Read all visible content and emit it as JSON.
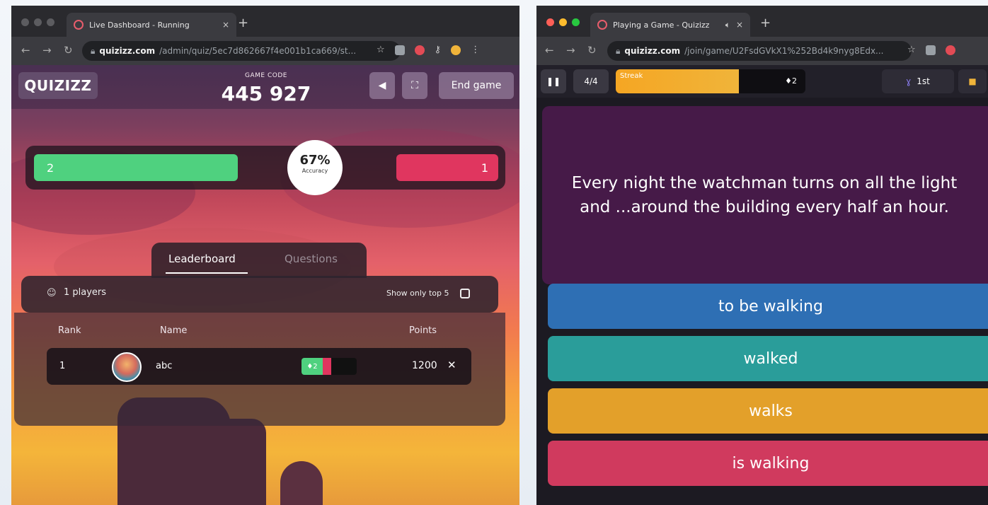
{
  "left_window": {
    "tab_title": "Live Dashboard - Running",
    "tab_close": "×",
    "new_tab": "+",
    "url_host": "quizizz.com",
    "url_path": "/admin/quiz/5ec7d862667f4e001b1ca669/st...",
    "app": {
      "logo": "QUIZIZZ",
      "game_code_label": "GAME CODE",
      "game_code": "445 927",
      "end_game_label": "End game",
      "accuracy": {
        "correct_count": "2",
        "incorrect_count": "1",
        "percent_text": "67%",
        "label": "Accuracy",
        "correct_color": "#4fd17f",
        "incorrect_color": "#e0365f"
      },
      "tabs": [
        "Leaderboard",
        "Questions"
      ],
      "players_label": "1 players",
      "show_top5_label": "Show only top 5",
      "columns": [
        "Rank",
        "Name",
        "Points"
      ],
      "rows": [
        {
          "rank": "1",
          "name": "abc",
          "streak": "2",
          "points": "1200"
        }
      ]
    }
  },
  "right_window": {
    "tab_title": "Playing a Game - Quizizz",
    "tab_close": "×",
    "new_tab": "+",
    "url_host": "quizizz.com",
    "url_path": "/join/game/U2FsdGVkX1%252Bd4k9nyg8Edx...",
    "game": {
      "progress": "4/4",
      "streak_label": "Streak",
      "streak_count": "2",
      "streak_fill_fraction": 0.65,
      "rank_label": "1st",
      "question": "Every night the watchman turns on all the light\nand ...around the building every half an hour.",
      "options": [
        {
          "text": "to be walking",
          "color": "#2e6fb4"
        },
        {
          "text": "walked",
          "color": "#2a9d9a"
        },
        {
          "text": "walks",
          "color": "#e3a02a"
        },
        {
          "text": "is walking",
          "color": "#d03a5e"
        }
      ]
    }
  }
}
